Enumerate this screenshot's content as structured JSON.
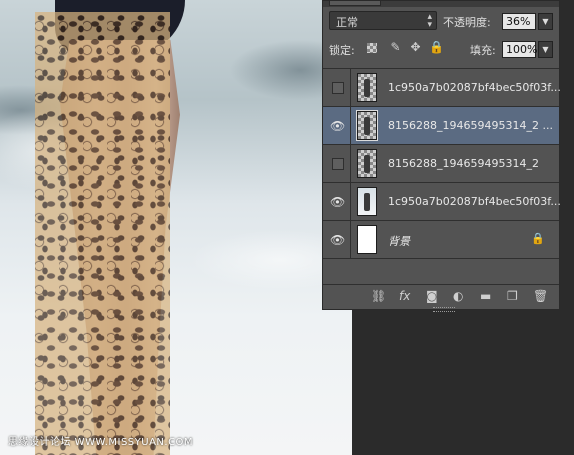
{
  "canvas": {
    "watermark": "思缘设计论坛 WWW.MISSYUAN.COM"
  },
  "panel": {
    "blend_mode": "正常",
    "opacity_label": "不透明度:",
    "opacity_value": "36%",
    "lock_label": "锁定:",
    "fill_label": "填充:",
    "fill_value": "100%",
    "lock_icons": [
      "lock-transparent-pixels-icon",
      "lock-image-pixels-icon",
      "lock-position-icon",
      "lock-all-icon"
    ]
  },
  "layers": [
    {
      "name": "1c950a7b02087bf4bec50f03f...",
      "visible": false,
      "thumb": "figure-transparent",
      "selected": false
    },
    {
      "name": "8156288_194659495314_2 ...",
      "visible": true,
      "thumb": "figure-transparent",
      "selected": true
    },
    {
      "name": "8156288_194659495314_2",
      "visible": false,
      "thumb": "figure-transparent",
      "selected": false
    },
    {
      "name": "1c950a7b02087bf4bec50f03f...",
      "visible": true,
      "thumb": "photo",
      "selected": false
    },
    {
      "name": "背景",
      "visible": true,
      "thumb": "white",
      "selected": false,
      "locked": true
    }
  ],
  "footer_icons": [
    "link-icon",
    "fx-icon",
    "mask-icon",
    "adjustment-icon",
    "folder-icon",
    "new-layer-icon",
    "trash-icon"
  ],
  "footer_fx": "fx"
}
